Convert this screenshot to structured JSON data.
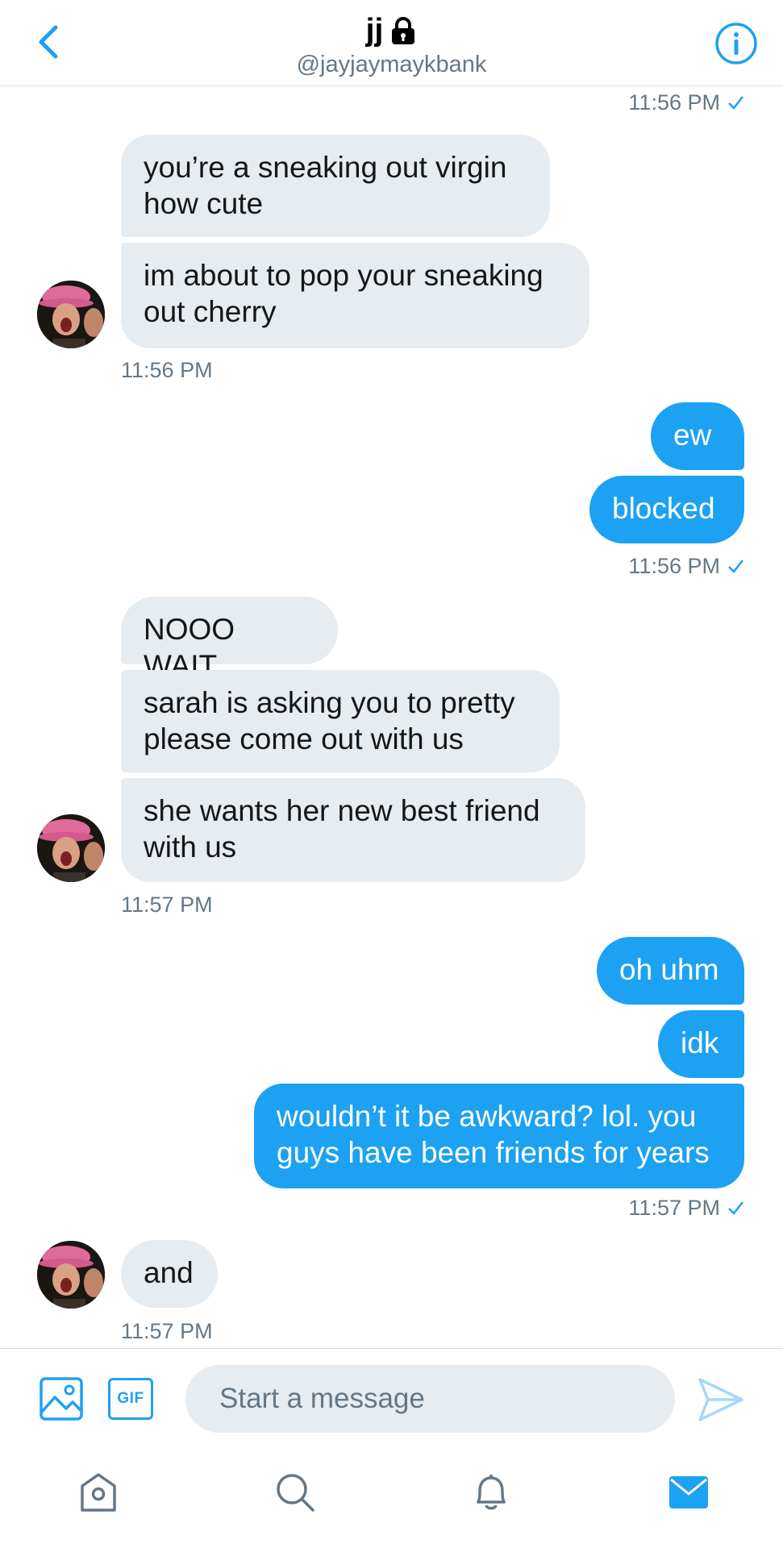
{
  "header": {
    "title": "jj",
    "handle": "@jayjaymaykbank"
  },
  "icons": {
    "back": "chevron-left-icon",
    "info": "info-icon",
    "lock": "lock-icon",
    "image": "image-icon",
    "gif": "gif-icon",
    "send": "send-icon",
    "home": "home-icon",
    "search": "search-icon",
    "notifications": "bell-icon",
    "messages": "mail-icon"
  },
  "colors": {
    "accent": "#1da1f2",
    "received_bubble": "#e6ecf0",
    "timestamp": "#657786"
  },
  "messages": {
    "ts_top": "11:56 PM",
    "r1": "you’re a sneaking out virgin\nhow cute",
    "r2": "im about to pop your sneaking\nout cherry",
    "ts_r_group1": "11:56 PM",
    "s1": "ew",
    "s2": "blocked",
    "ts_s_group1": "11:56 PM",
    "r3": "NOOO WAIT",
    "r4": "sarah is asking you to pretty\nplease come out with us",
    "r5": "she wants her new best friend\nwith us",
    "ts_r_group2": "11:57 PM",
    "s3": "oh uhm",
    "s4": "idk",
    "s5": "wouldn’t it be awkward? lol. you\nguys have been friends for years",
    "ts_s_group2": "11:57 PM",
    "r6": "and",
    "ts_r_group3": "11:57 PM"
  },
  "composer": {
    "gif_label": "GIF",
    "placeholder": "Start a message"
  }
}
